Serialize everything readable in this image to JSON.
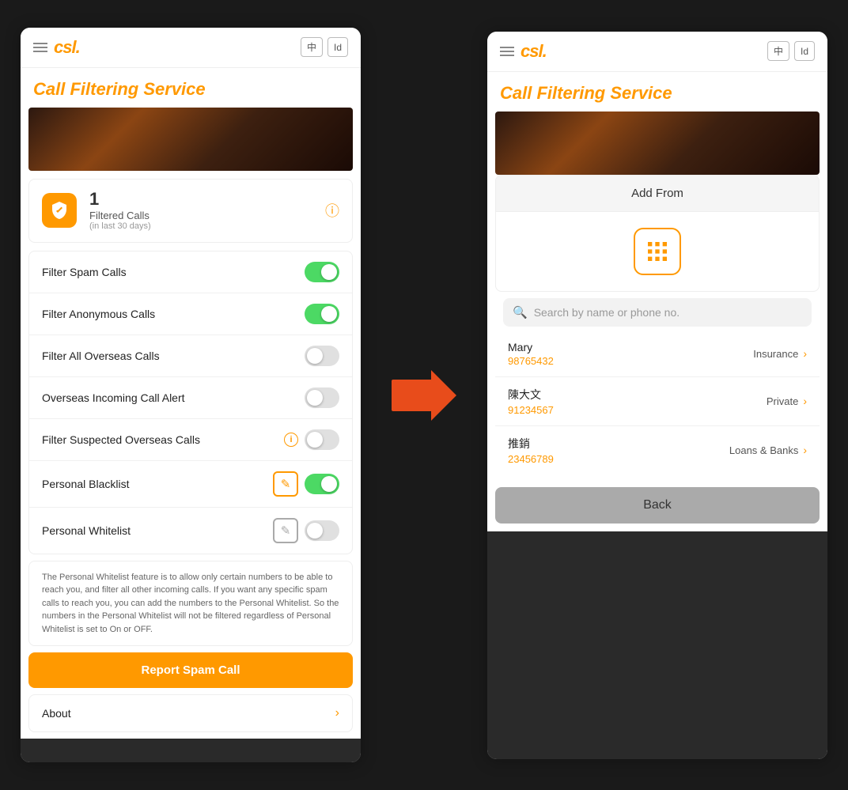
{
  "app": {
    "name": "CSL",
    "logo": "csl.",
    "lang_buttons": [
      "中",
      "Id"
    ]
  },
  "left_screen": {
    "title": "Call Filtering Service",
    "filtered_calls": {
      "count": "1",
      "label": "Filtered Calls",
      "sublabel": "(in last 30 days)"
    },
    "settings": [
      {
        "id": "filter-spam",
        "label": "Filter Spam Calls",
        "toggle": "on",
        "has_info": false,
        "has_edit": false
      },
      {
        "id": "filter-anonymous",
        "label": "Filter Anonymous Calls",
        "toggle": "on",
        "has_info": false,
        "has_edit": false
      },
      {
        "id": "filter-overseas",
        "label": "Filter All Overseas Calls",
        "toggle": "off",
        "has_info": false,
        "has_edit": false
      },
      {
        "id": "overseas-alert",
        "label": "Overseas Incoming Call Alert",
        "toggle": "off",
        "has_info": false,
        "has_edit": false
      },
      {
        "id": "filter-suspected",
        "label": "Filter Suspected Overseas Calls",
        "toggle": "off",
        "has_info": true,
        "has_edit": false
      },
      {
        "id": "personal-blacklist",
        "label": "Personal Blacklist",
        "toggle": "on",
        "has_info": false,
        "has_edit": true
      },
      {
        "id": "personal-whitelist",
        "label": "Personal Whitelist",
        "toggle": "off",
        "has_info": false,
        "has_edit": true
      }
    ],
    "description": "The Personal Whitelist feature is to allow only certain numbers to be able to reach you, and filter all other incoming calls. If you want any specific spam calls to reach you, you can add the numbers to the Personal Whitelist. So the numbers in the Personal Whitelist will not be filtered regardless of Personal Whitelist is set to On or OFF.",
    "report_btn": "Report Spam Call",
    "about_label": "About"
  },
  "right_screen": {
    "title": "Call Filtering Service",
    "add_from_title": "Add From",
    "search_placeholder": "Search by name or phone no.",
    "contacts_icon_label": "contacts-grid-icon",
    "contacts": [
      {
        "name": "Mary",
        "number": "98765432",
        "tag": "Insurance"
      },
      {
        "name": "陳大文",
        "number": "91234567",
        "tag": "Private"
      },
      {
        "name": "推銷",
        "number": "23456789",
        "tag": "Loans & Banks"
      }
    ],
    "back_btn": "Back"
  },
  "icons": {
    "hamburger": "☰",
    "info": "i",
    "edit": "✎",
    "chevron_right": "›",
    "search": "🔍"
  }
}
